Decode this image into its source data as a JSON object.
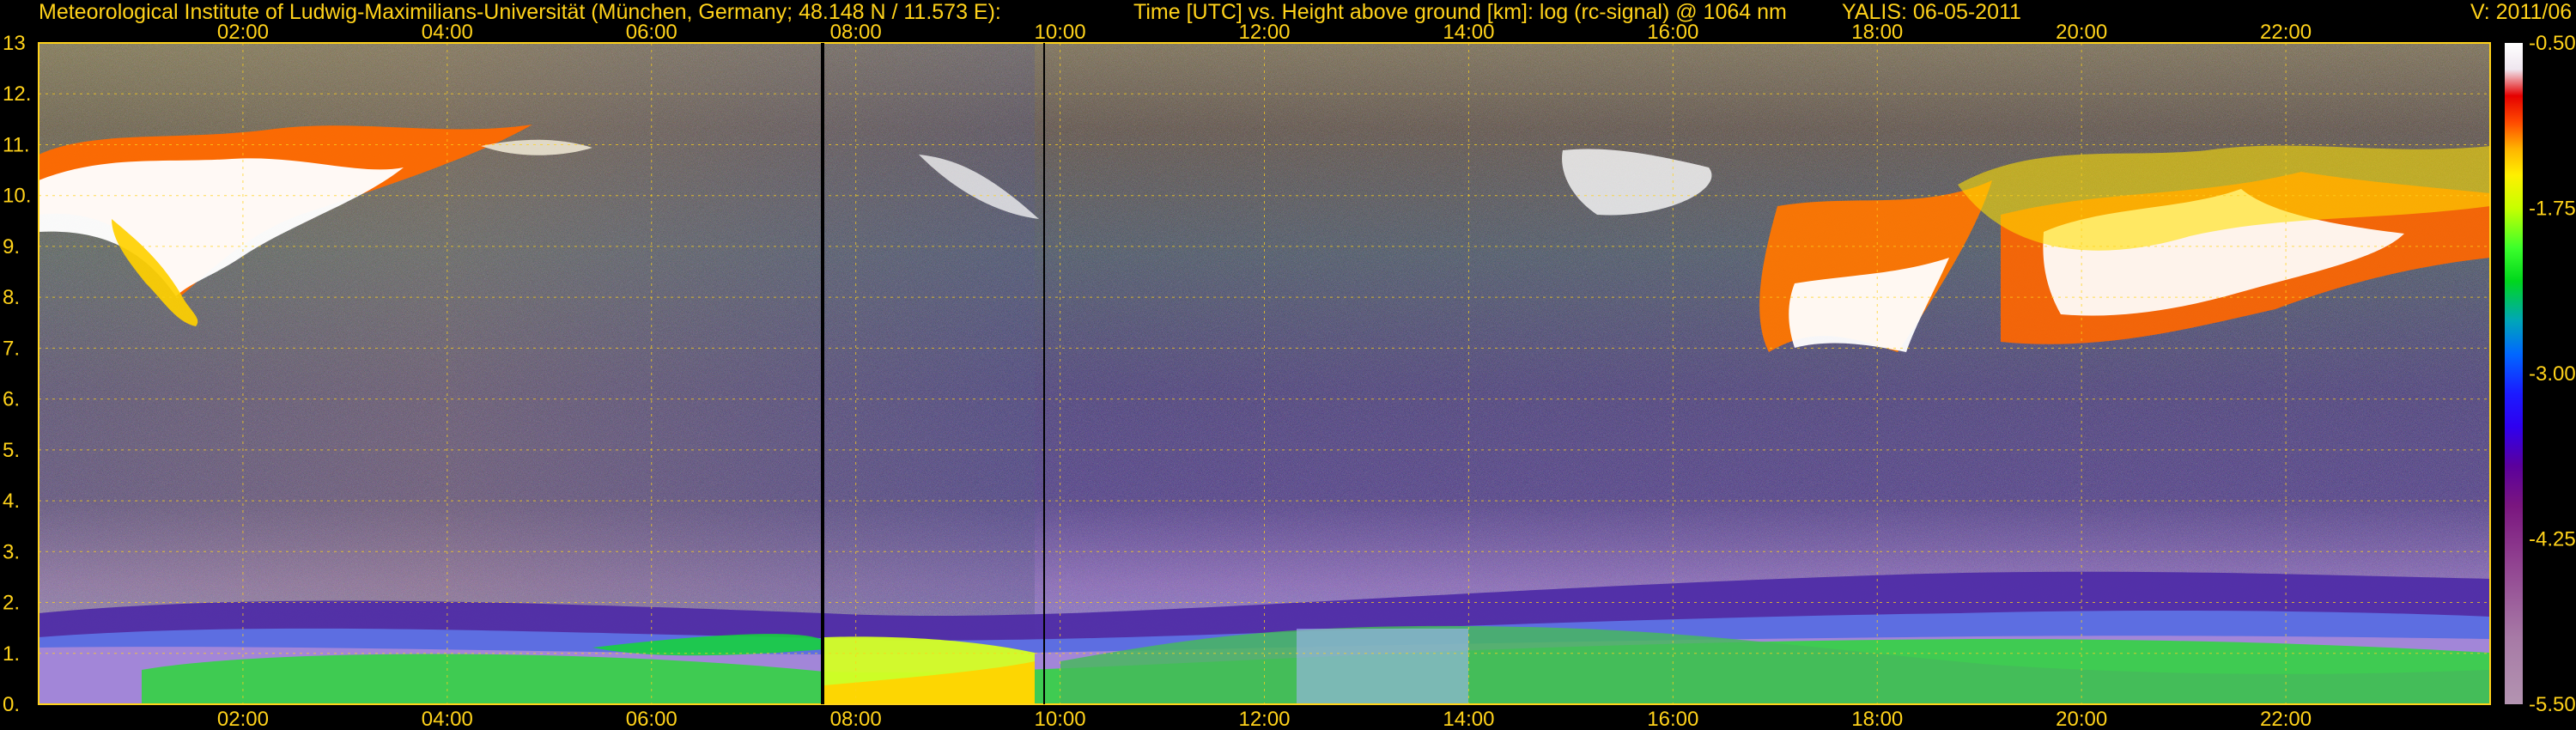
{
  "header": {
    "institute": "Meteorological Institute of Ludwig-Maximilians-Universität (München, Germany; 48.148 N / 11.573 E):",
    "plot_description": "Time [UTC] vs. Height above ground [km]: log (rc-signal) @ 1064 nm",
    "instrument_date": "YALIS: 06-05-2011",
    "version": "V: 2011/06"
  },
  "colors": {
    "text": "#ffd21a",
    "grid": "#ffd21a",
    "background": "#000000",
    "colorbar": [
      "#ffffff",
      "#efe6ef",
      "#e50000",
      "#ff4a00",
      "#ffb300",
      "#fff000",
      "#c7ff00",
      "#3cff2b",
      "#00d71d",
      "#00a6b8",
      "#0068ff",
      "#1b1bff",
      "#2e00f0",
      "#5b009c",
      "#7a167f",
      "#8f3f8f",
      "#a77aa6",
      "#b394b1"
    ]
  },
  "chart_data": {
    "type": "heatmap",
    "title": "Time [UTC] vs. Height above ground [km]: log (rc-signal) @ 1064 nm",
    "xlabel": "Time [UTC]",
    "ylabel": "Height above ground [km]",
    "xlim": [
      "00:00",
      "24:00"
    ],
    "ylim": [
      0,
      13
    ],
    "x_ticks": [
      "02:00",
      "04:00",
      "06:00",
      "08:00",
      "10:00",
      "12:00",
      "14:00",
      "16:00",
      "18:00",
      "20:00",
      "22:00"
    ],
    "x_tick_hours": [
      2,
      4,
      6,
      8,
      10,
      12,
      14,
      16,
      18,
      20,
      22
    ],
    "y_ticks": [
      "0.",
      "1.",
      "2.",
      "3.",
      "4.",
      "5.",
      "6.",
      "7.",
      "8.",
      "9.",
      "10.",
      "11.",
      "12.",
      "13"
    ],
    "y_tick_values": [
      0,
      1,
      2,
      3,
      4,
      5,
      6,
      7,
      8,
      9,
      10,
      11,
      12,
      13
    ],
    "grid": true,
    "colorbar": {
      "ticks": [
        "-0.50",
        "-1.75",
        "-3.00",
        "-4.25",
        "-5.50"
      ],
      "tick_values": [
        -0.5,
        -1.75,
        -3.0,
        -4.25,
        -5.5
      ],
      "range": [
        -5.5,
        -0.5
      ]
    },
    "features": [
      {
        "kind": "cirrus",
        "start_hour": 0.0,
        "end_hour": 4.0,
        "base_km": 7.8,
        "top_km": 11.0
      },
      {
        "kind": "cirrus",
        "start_hour": 4.3,
        "end_hour": 5.3,
        "base_km": 10.6,
        "top_km": 11.2
      },
      {
        "kind": "cirrus",
        "start_hour": 8.9,
        "end_hour": 9.9,
        "base_km": 9.8,
        "top_km": 11.0
      },
      {
        "kind": "cirrus",
        "start_hour": 14.7,
        "end_hour": 16.0,
        "base_km": 9.5,
        "top_km": 11.0
      },
      {
        "kind": "cirrus",
        "start_hour": 16.2,
        "end_hour": 18.3,
        "base_km": 6.5,
        "top_km": 8.8
      },
      {
        "kind": "cirrus",
        "start_hour": 18.4,
        "end_hour": 24.0,
        "base_km": 7.3,
        "top_km": 11.2
      },
      {
        "kind": "boundary-layer",
        "start_hour": 0.0,
        "end_hour": 24.0,
        "base_km": 0.0,
        "top_km": 2.0
      }
    ]
  }
}
